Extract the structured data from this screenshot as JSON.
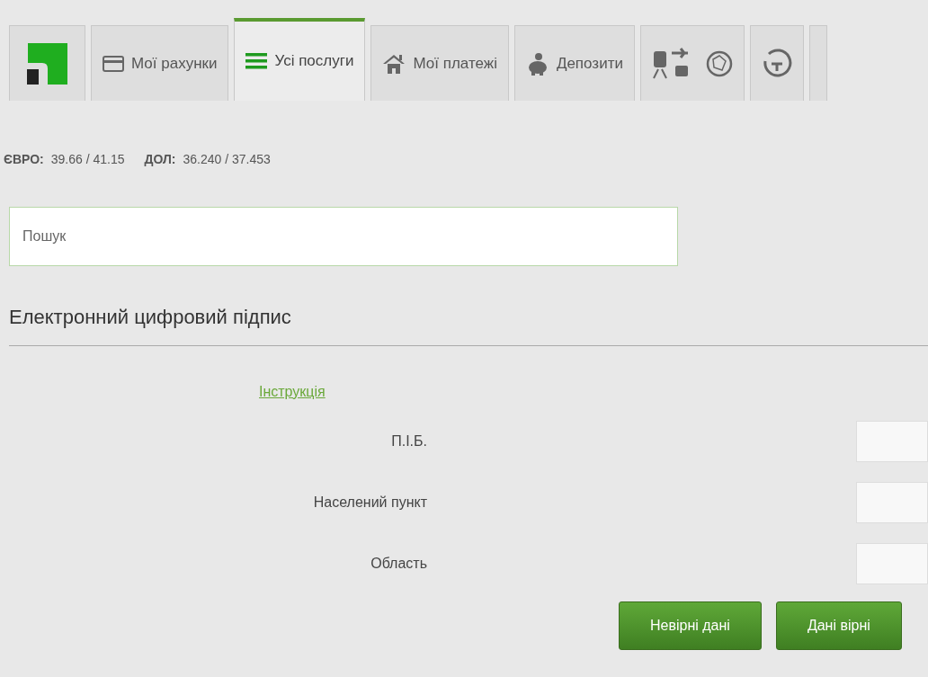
{
  "tabs": [
    {
      "kind": "logo",
      "selected": false
    },
    {
      "kind": "card",
      "label": "Мої рахунки",
      "selected": false
    },
    {
      "kind": "list",
      "label": "Усі послуги",
      "selected": true
    },
    {
      "kind": "house",
      "label": "Мої платежі",
      "selected": false
    },
    {
      "kind": "piggy",
      "label": "Депозити",
      "selected": false
    },
    {
      "kind": "travel",
      "selected": false
    },
    {
      "kind": "clock",
      "selected": false
    },
    {
      "kind": "partial",
      "selected": false
    }
  ],
  "rates": [
    {
      "currency": "ЄВРО:",
      "value": "39.66 / 41.15"
    },
    {
      "currency": "ДОЛ:",
      "value": "36.240 / 37.453"
    }
  ],
  "search": {
    "placeholder": "Пошук"
  },
  "section_title": "Електронний цифровий підпис",
  "instruction_link": "Інструкція",
  "fields": [
    {
      "label": "П.І.Б."
    },
    {
      "label": "Населений пункт"
    },
    {
      "label": "Область"
    }
  ],
  "buttons": [
    "Невірні дані",
    "Дані вірні"
  ]
}
